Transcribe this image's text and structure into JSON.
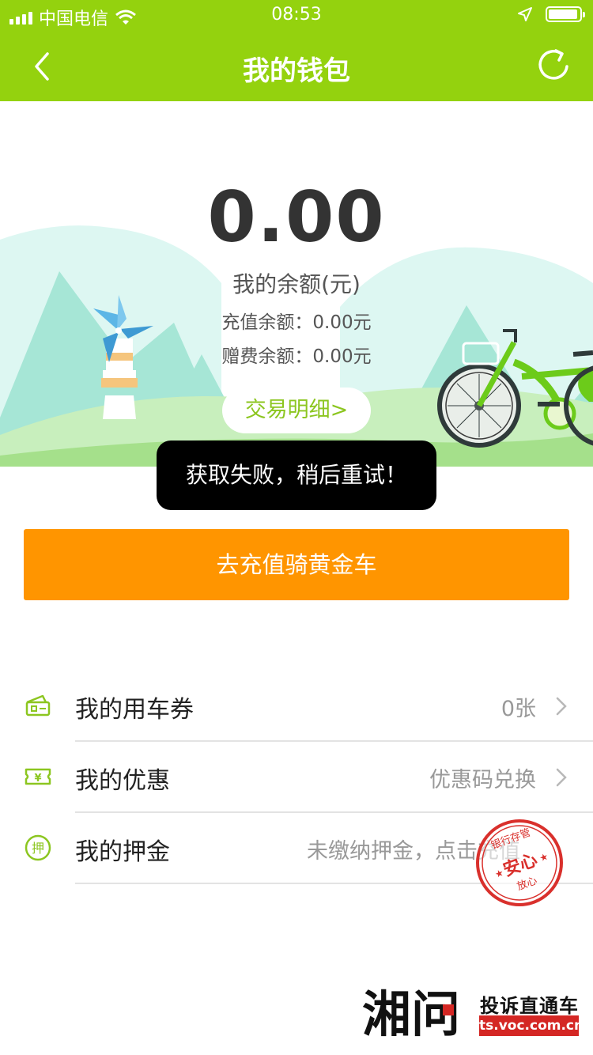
{
  "status_bar": {
    "carrier": "中国电信",
    "time": "08:53",
    "icons": [
      "signal-icon",
      "wifi-icon",
      "location-arrow-icon",
      "battery-icon"
    ]
  },
  "header": {
    "title": "我的钱包",
    "back_icon": "chevron-left-icon",
    "refresh_icon": "refresh-icon"
  },
  "wallet": {
    "balance": "0.00",
    "balance_label": "我的余额(元)",
    "recharge_balance": "充值余额：0.00元",
    "gift_balance": "赠费余额：0.00元",
    "detail_button": "交易明细>"
  },
  "toast": {
    "message": "获取失败，稍后重试！"
  },
  "cta": {
    "label": "去充值骑黄金车"
  },
  "menu": [
    {
      "label": "我的用车券",
      "value": "0张",
      "icon": "ticket-icon"
    },
    {
      "label": "我的优惠",
      "value": "优惠码兑换",
      "icon": "yen-coupon-icon"
    },
    {
      "label": "我的押金",
      "value": "未缴纳押金，点击充值",
      "icon": "deposit-icon",
      "icon_text": "押"
    }
  ],
  "stamp": {
    "top_text": "银行存管",
    "center_text": "安心",
    "bottom_text": "放心"
  },
  "watermark": {
    "logo_text": "湘问",
    "title": "投诉直通车",
    "url": "ts.voc.com.cn"
  },
  "colors": {
    "theme_green": "#94d20e",
    "accent_orange": "#ff9500",
    "detail_green": "#8cc620",
    "stamp_red": "#d9302c"
  }
}
